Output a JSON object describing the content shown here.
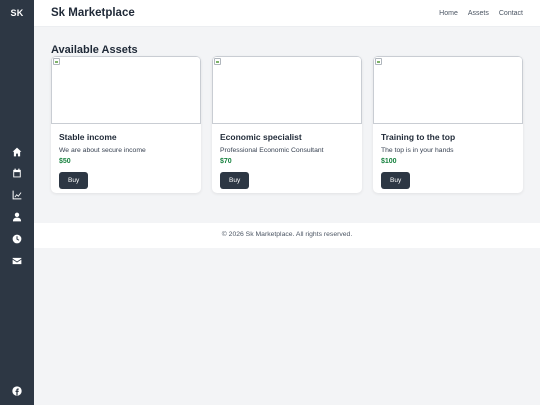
{
  "sidebar": {
    "logo": "SK",
    "icons": [
      "home-icon",
      "calendar-icon",
      "chart-line-icon",
      "user-icon",
      "clock-icon",
      "envelope-icon",
      "facebook-icon"
    ]
  },
  "header": {
    "brand": "Sk Marketplace",
    "nav": [
      "Home",
      "Assets",
      "Contact"
    ]
  },
  "main": {
    "title": "Available Assets",
    "cards": [
      {
        "title": "Stable income",
        "description": "We are about secure income",
        "price": "$50",
        "button": "Buy"
      },
      {
        "title": "Economic specialist",
        "description": "Professional Economic Consultant",
        "price": "$70",
        "button": "Buy"
      },
      {
        "title": "Training to the top",
        "description": "The top is in your hands",
        "price": "$100",
        "button": "Buy"
      }
    ]
  },
  "footer": {
    "text": "© 2026 Sk Marketplace. All rights reserved."
  },
  "colors": {
    "sidebar": "#2d3744",
    "price": "#15803d",
    "button": "#2d3744",
    "background": "#f3f4f6"
  }
}
